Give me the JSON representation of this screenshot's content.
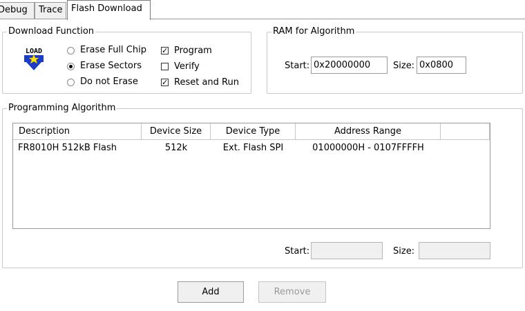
{
  "tabs": [
    {
      "label": "Debug"
    },
    {
      "label": "Trace"
    },
    {
      "label": "Flash Download",
      "active": true
    }
  ],
  "download_function": {
    "title": "Download Function",
    "icon_text": "LOAD",
    "erase_options": [
      {
        "label": "Erase Full Chip",
        "selected": false
      },
      {
        "label": "Erase Sectors",
        "selected": true
      },
      {
        "label": "Do not Erase",
        "selected": false
      }
    ],
    "checks": [
      {
        "label": "Program",
        "checked": true
      },
      {
        "label": "Verify",
        "checked": false
      },
      {
        "label": "Reset and Run",
        "checked": true
      }
    ]
  },
  "ram_for_algorithm": {
    "title": "RAM for Algorithm",
    "start_label": "Start:",
    "start_value": "0x20000000",
    "size_label": "Size:",
    "size_value": "0x0800"
  },
  "programming_algorithm": {
    "title": "Programming Algorithm",
    "columns": [
      "Description",
      "Device Size",
      "Device Type",
      "Address Range"
    ],
    "rows": [
      [
        "FR8010H 512kB Flash",
        "512k",
        "Ext. Flash SPI",
        "01000000H - 0107FFFFH"
      ]
    ],
    "start_label": "Start:",
    "start_value": "",
    "size_label": "Size:",
    "size_value": ""
  },
  "buttons": {
    "add": "Add",
    "remove": "Remove"
  }
}
